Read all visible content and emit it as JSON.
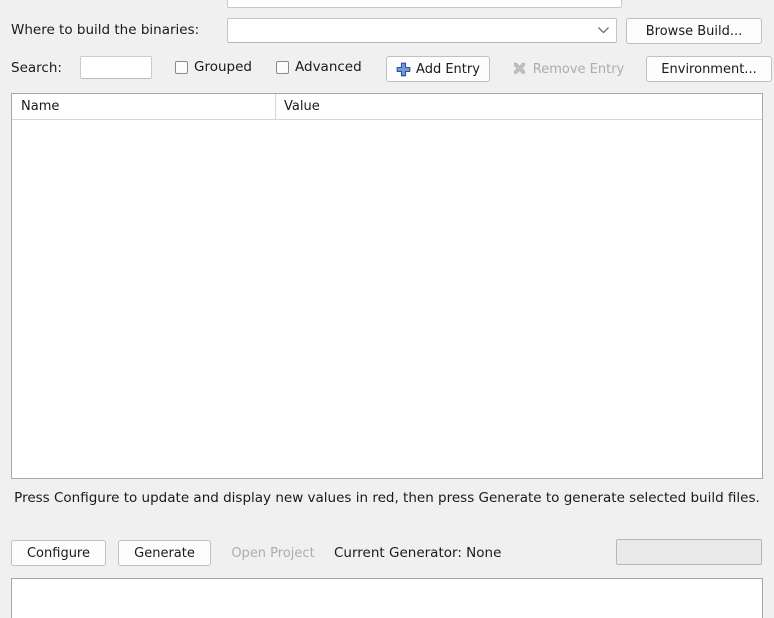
{
  "window": {
    "background_color": "#f0f0f0",
    "accent_color": "#3a8ee6"
  },
  "build_row": {
    "label": "Where to build the binaries:",
    "combo_value": "",
    "combo_placeholder": "",
    "browse_button": "Browse Build...",
    "dropdown_icon": "chevron-down-icon"
  },
  "search_row": {
    "label": "Search:",
    "search_value": "",
    "search_placeholder": "",
    "grouped_label": "Grouped",
    "grouped_checked": false,
    "advanced_label": "Advanced",
    "advanced_checked": false,
    "add_entry_label": "Add Entry",
    "add_entry_icon": "plus-icon",
    "add_entry_icon_color": "#4a72c4",
    "remove_entry_label": "Remove Entry",
    "remove_entry_icon": "x-mark-icon",
    "remove_entry_enabled": false,
    "environment_label": "Environment..."
  },
  "cache_table": {
    "columns": [
      "Name",
      "Value"
    ],
    "rows": []
  },
  "hint": {
    "text": "Press Configure to update and display new values in red, then press Generate to generate selected build files."
  },
  "actions": {
    "configure_label": "Configure",
    "generate_label": "Generate",
    "open_project_label": "Open Project",
    "open_project_enabled": false,
    "current_generator": "Current Generator: None",
    "progress_percent": 0
  },
  "output": {
    "text": ""
  }
}
